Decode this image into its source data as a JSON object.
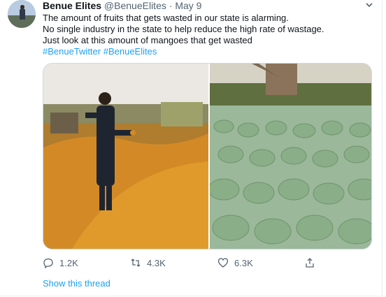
{
  "tweet": {
    "author_name": "Benue Elites",
    "handle": "@BenueElites",
    "separator": "·",
    "date": "May 9",
    "text_lines": [
      "The amount of fruits that gets wasted in our state is alarming.",
      "No single industry in the state to help reduce the high rate of wastage.",
      "Just look at this amount of mangoes that get wasted"
    ],
    "hashtags": [
      "#BenueTwitter",
      "#BenueElites"
    ]
  },
  "media": {
    "left_photo": "mangoes-field-man-photo",
    "right_photo": "mango-pile-photo"
  },
  "actions": {
    "reply_count": "1.2K",
    "retweet_count": "4.3K",
    "like_count": "6.3K",
    "reply_icon": "reply-icon",
    "retweet_icon": "retweet-icon",
    "like_icon": "heart-icon",
    "share_icon": "share-icon"
  },
  "thread_link": "Show this thread",
  "colors": {
    "accent": "#1da1f2",
    "secondary_text": "#536471",
    "primary_text": "#0f1419"
  }
}
